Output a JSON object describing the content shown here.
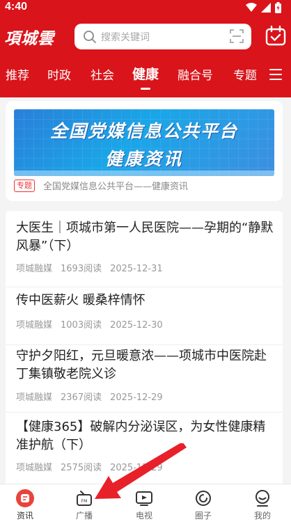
{
  "colors": {
    "brand_red": "#d9141b",
    "banner_blue": "#2a7fd8",
    "tag_red": "#e33333"
  },
  "status_bar": {
    "time": "4:40"
  },
  "header": {
    "logo_text": "項城雲",
    "search_placeholder": "搜索关键词"
  },
  "tabs": [
    {
      "label": "推荐"
    },
    {
      "label": "时政"
    },
    {
      "label": "社会"
    },
    {
      "label": "健康"
    },
    {
      "label": "融合号"
    },
    {
      "label": "专题"
    }
  ],
  "active_tab": "健康",
  "banner": {
    "line1": "全国党媒信息公共平台",
    "line2": "健康资讯",
    "tag": "专题",
    "caption": "全国党媒信息公共平台——健康资讯"
  },
  "news": [
    {
      "title": "大医生｜项城市第一人民医院——孕期的“静默风暴”（下）",
      "source": "项城融媒",
      "reads": "1693阅读",
      "date": "2025-12-31"
    },
    {
      "title": "传中医薪火 暖桑梓情怀",
      "source": "项城融媒",
      "reads": "1003阅读",
      "date": "2025-12-30"
    },
    {
      "title": "守护夕阳红，元旦暖意浓——项城市中医院赴丁集镇敬老院义诊",
      "source": "项城融媒",
      "reads": "2367阅读",
      "date": "2025-12-29"
    },
    {
      "title": "【健康365】破解内分泌误区，为女性健康精准护航（下）",
      "source": "项城融媒",
      "reads": "2575阅读",
      "date": "2025-12-29"
    }
  ],
  "bottom_nav": [
    {
      "label": "资讯",
      "icon": "news-icon",
      "active": true
    },
    {
      "label": "广播",
      "icon": "radio-icon",
      "active": false
    },
    {
      "label": "电视",
      "icon": "tv-icon",
      "active": false
    },
    {
      "label": "圈子",
      "icon": "circle-icon",
      "active": false
    },
    {
      "label": "我的",
      "icon": "profile-icon",
      "active": false
    }
  ]
}
